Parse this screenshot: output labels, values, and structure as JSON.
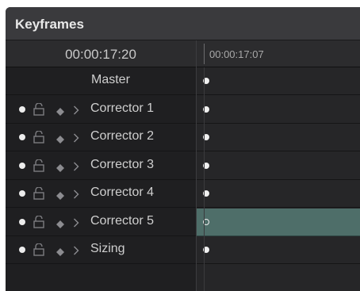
{
  "panel": {
    "title": "Keyframes"
  },
  "header": {
    "current_timecode": "00:00:17:20",
    "ruler_timecode": "00:00:17:07"
  },
  "rows": [
    {
      "label": "Master",
      "has_controls": false,
      "keyframe": "filled",
      "selected": false
    },
    {
      "label": "Corrector 1",
      "has_controls": true,
      "keyframe": "filled",
      "selected": false
    },
    {
      "label": "Corrector 2",
      "has_controls": true,
      "keyframe": "filled",
      "selected": false
    },
    {
      "label": "Corrector 3",
      "has_controls": true,
      "keyframe": "filled",
      "selected": false
    },
    {
      "label": "Corrector 4",
      "has_controls": true,
      "keyframe": "filled",
      "selected": false
    },
    {
      "label": "Corrector 5",
      "has_controls": true,
      "keyframe": "hollow",
      "selected": true
    },
    {
      "label": "Sizing",
      "has_controls": true,
      "keyframe": "filled",
      "selected": false
    }
  ],
  "icons": {
    "enable": "dot-icon",
    "lock": "lock-icon",
    "keyframe": "diamond-icon",
    "expand": "chevron-right-icon"
  },
  "colors": {
    "panel_bg": "#232325",
    "title_bg": "#3a3a3d",
    "selected_row": "#4e6e69",
    "text": "#cfcfcf"
  }
}
